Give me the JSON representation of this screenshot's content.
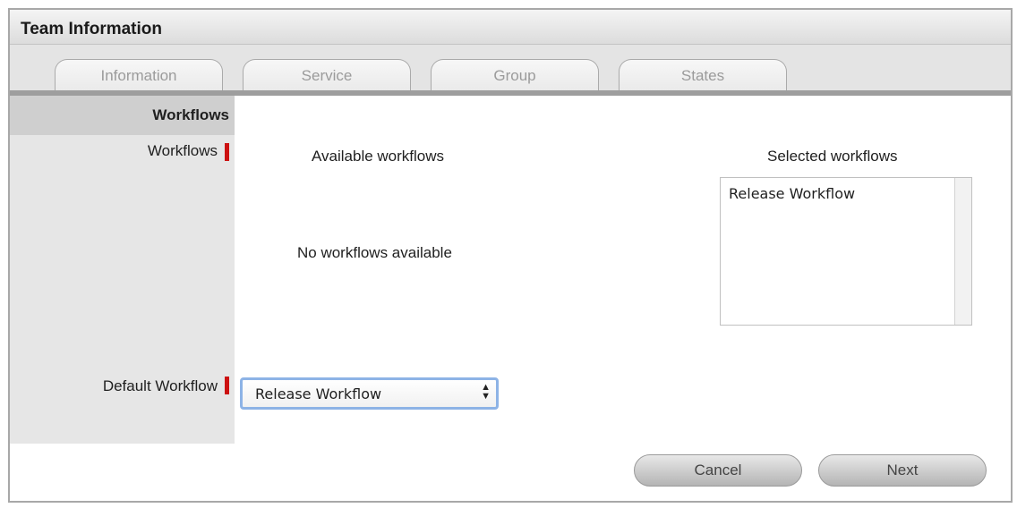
{
  "header": {
    "title": "Team Information"
  },
  "tabs": [
    {
      "label": "Information"
    },
    {
      "label": "Service"
    },
    {
      "label": "Group"
    },
    {
      "label": "States"
    }
  ],
  "sidebar": {
    "section_title": "Workflows",
    "workflows_label": "Workflows",
    "default_workflow_label": "Default Workflow"
  },
  "workflows": {
    "available_title": "Available workflows",
    "empty_message": "No workflows available",
    "selected_title": "Selected workflows",
    "selected_items": [
      "Release Workflow"
    ]
  },
  "default_workflow": {
    "value": "Release Workflow"
  },
  "buttons": {
    "cancel": "Cancel",
    "next": "Next"
  },
  "colors": {
    "required_marker": "#cc1111",
    "focus_ring": "#8db3e6"
  }
}
